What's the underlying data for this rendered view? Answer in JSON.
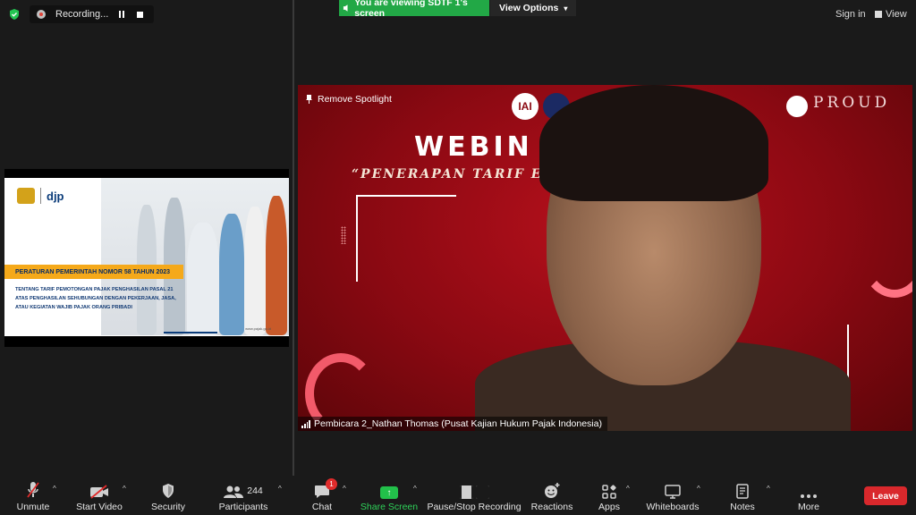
{
  "top_bar": {
    "recording_label": "Recording...",
    "viewing_banner": "You are viewing SDTF 1's screen",
    "view_options_label": "View Options",
    "sign_in_label": "Sign in",
    "view_label": "View"
  },
  "share": {
    "brand": "djp",
    "regulation_title": "PERATURAN PEMERINTAH NOMOR 58 TAHUN 2023",
    "regulation_subtitle": "TENTANG TARIF PEMOTONGAN PAJAK PENGHASILAN PASAL 21 ATAS PENGHASILAN SEHUBUNGAN DENGAN PEKERJAAN, JASA, ATAU KEGIATAN WAJIB PAJAK ORANG PRIBADI",
    "url": "www.pajak.go.id"
  },
  "video": {
    "remove_spotlight_label": "Remove Spotlight",
    "banner_title": "WEBIN          AKAN",
    "banner_tagline": "“PENERAPAN TARIF EF                              DA PPH PASAL 21”",
    "sponsor": "PROUD",
    "participant_name": "Pembicara 2_Nathan Thomas (Pusat Kajian Hukum Pajak Indonesia)"
  },
  "toolbar": {
    "unmute": "Unmute",
    "start_video": "Start Video",
    "security": "Security",
    "participants": "Participants",
    "participants_count": "244",
    "chat": "Chat",
    "chat_badge": "1",
    "share_screen": "Share Screen",
    "pause_stop_recording": "Pause/Stop Recording",
    "reactions": "Reactions",
    "apps": "Apps",
    "whiteboards": "Whiteboards",
    "notes": "Notes",
    "more": "More",
    "leave": "Leave"
  },
  "colors": {
    "accent_green": "#22a846",
    "leave_red": "#d9282c",
    "background": "#1a1a1a"
  }
}
